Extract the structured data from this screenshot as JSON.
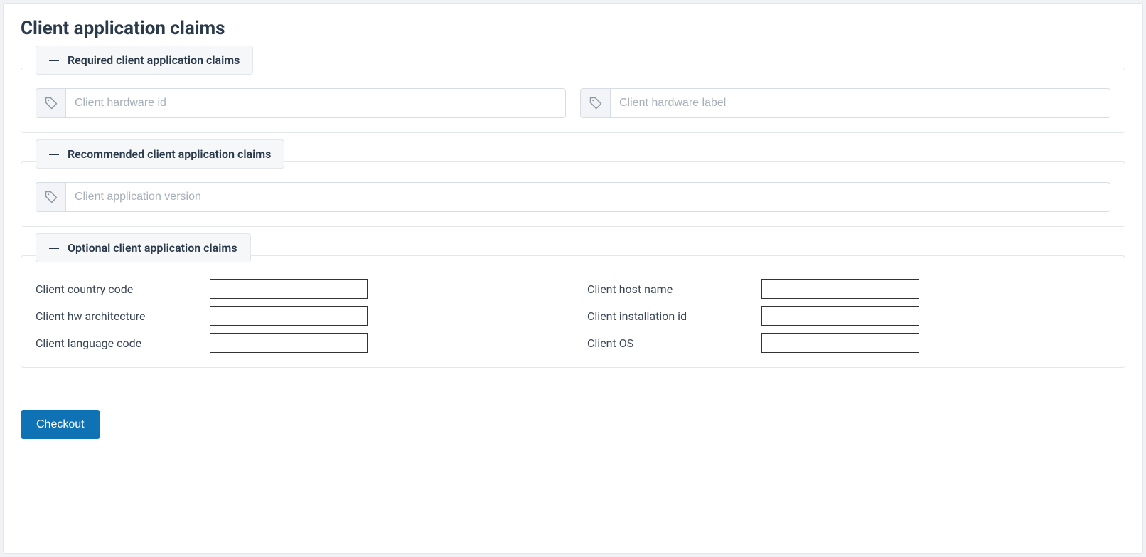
{
  "page": {
    "title": "Client application claims",
    "checkout_label": "Checkout"
  },
  "required": {
    "legend": "Required client application claims",
    "hardware_id_placeholder": "Client hardware id",
    "hardware_label_placeholder": "Client hardware label"
  },
  "recommended": {
    "legend": "Recommended client application claims",
    "app_version_placeholder": "Client application version"
  },
  "optional": {
    "legend": "Optional client application claims",
    "country_code_label": "Client country code",
    "host_name_label": "Client host name",
    "hw_arch_label": "Client hw architecture",
    "installation_id_label": "Client installation id",
    "language_code_label": "Client language code",
    "os_label": "Client OS"
  }
}
